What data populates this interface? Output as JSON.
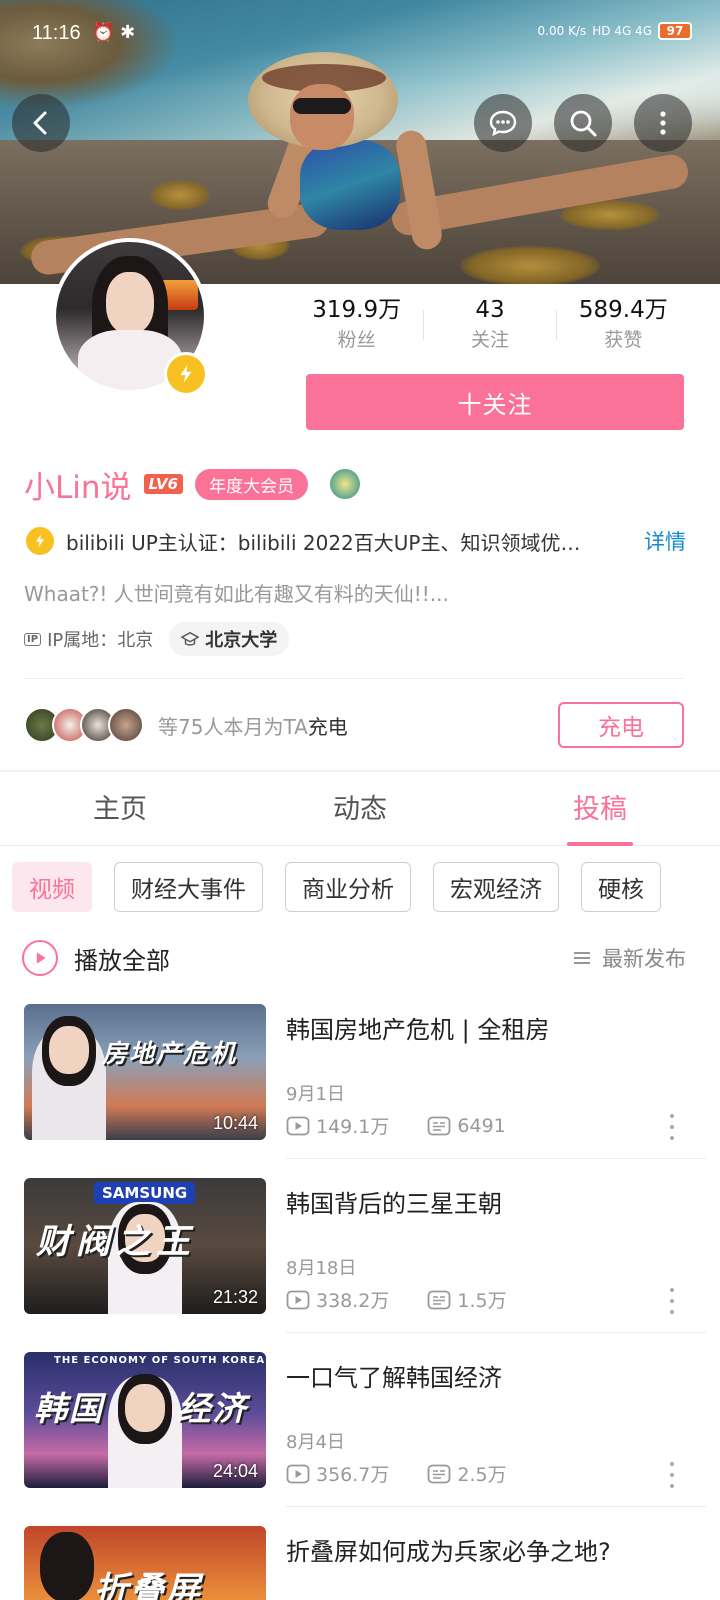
{
  "status_bar": {
    "time": "11:16",
    "icons": "⏰ ✱",
    "net_speed": "0.00 K/s",
    "network": "HD 4G 4G",
    "battery": "97"
  },
  "header": {
    "back_icon": "back-arrow-icon",
    "message_icon": "message-bubble-icon",
    "search_icon": "search-icon",
    "more_icon": "more-vertical-icon"
  },
  "profile": {
    "username": "小Lin说",
    "level": "LV6",
    "vip_label": "年度大会员",
    "stats": [
      {
        "num": "319.9万",
        "label": "粉丝"
      },
      {
        "num": "43",
        "label": "关注"
      },
      {
        "num": "589.4万",
        "label": "获赞"
      }
    ],
    "follow_label": "十关注",
    "verify_text": "bilibili UP主认证：bilibili 2022百大UP主、知识领域优…",
    "verify_link": "详情",
    "sign": "Whaat?! 人世间竟有如此有趣又有料的天仙!!...",
    "ip_badge": "IP",
    "ip_location": "IP属地：北京",
    "school": "北京大学"
  },
  "charge": {
    "text_prefix": "等75人本月为TA",
    "text_bold": "充电",
    "button": "充电"
  },
  "tabs": [
    {
      "label": "主页",
      "active": false
    },
    {
      "label": "动态",
      "active": false
    },
    {
      "label": "投稿",
      "active": true
    }
  ],
  "chips": [
    {
      "label": "视频",
      "active": true
    },
    {
      "label": "财经大事件",
      "active": false
    },
    {
      "label": "商业分析",
      "active": false
    },
    {
      "label": "宏观经济",
      "active": false
    },
    {
      "label": "硬核",
      "active": false
    }
  ],
  "playall": {
    "label": "播放全部",
    "sort_label": "最新发布"
  },
  "videos": [
    {
      "title": "韩国房地产危机 | 全租房",
      "date": "9月1日",
      "views": "149.1万",
      "danmaku": "6491",
      "duration": "10:44",
      "thumb_text": "房地产危机"
    },
    {
      "title": "韩国背后的三星王朝",
      "date": "8月18日",
      "views": "338.2万",
      "danmaku": "1.5万",
      "duration": "21:32",
      "thumb_text": "财阀之王",
      "thumb_badge": "SAMSUNG"
    },
    {
      "title": "一口气了解韩国经济",
      "date": "8月4日",
      "views": "356.7万",
      "danmaku": "2.5万",
      "duration": "24:04",
      "thumb_text": "韩国 经济",
      "thumb_top": "THE ECONOMY OF SOUTH KOREA"
    },
    {
      "title": "折叠屏如何成为兵家必争之地?",
      "thumb_text": "折叠屏"
    }
  ],
  "colors": {
    "accent": "#fb7299",
    "link": "#178bcf",
    "verify": "#f7c221"
  }
}
